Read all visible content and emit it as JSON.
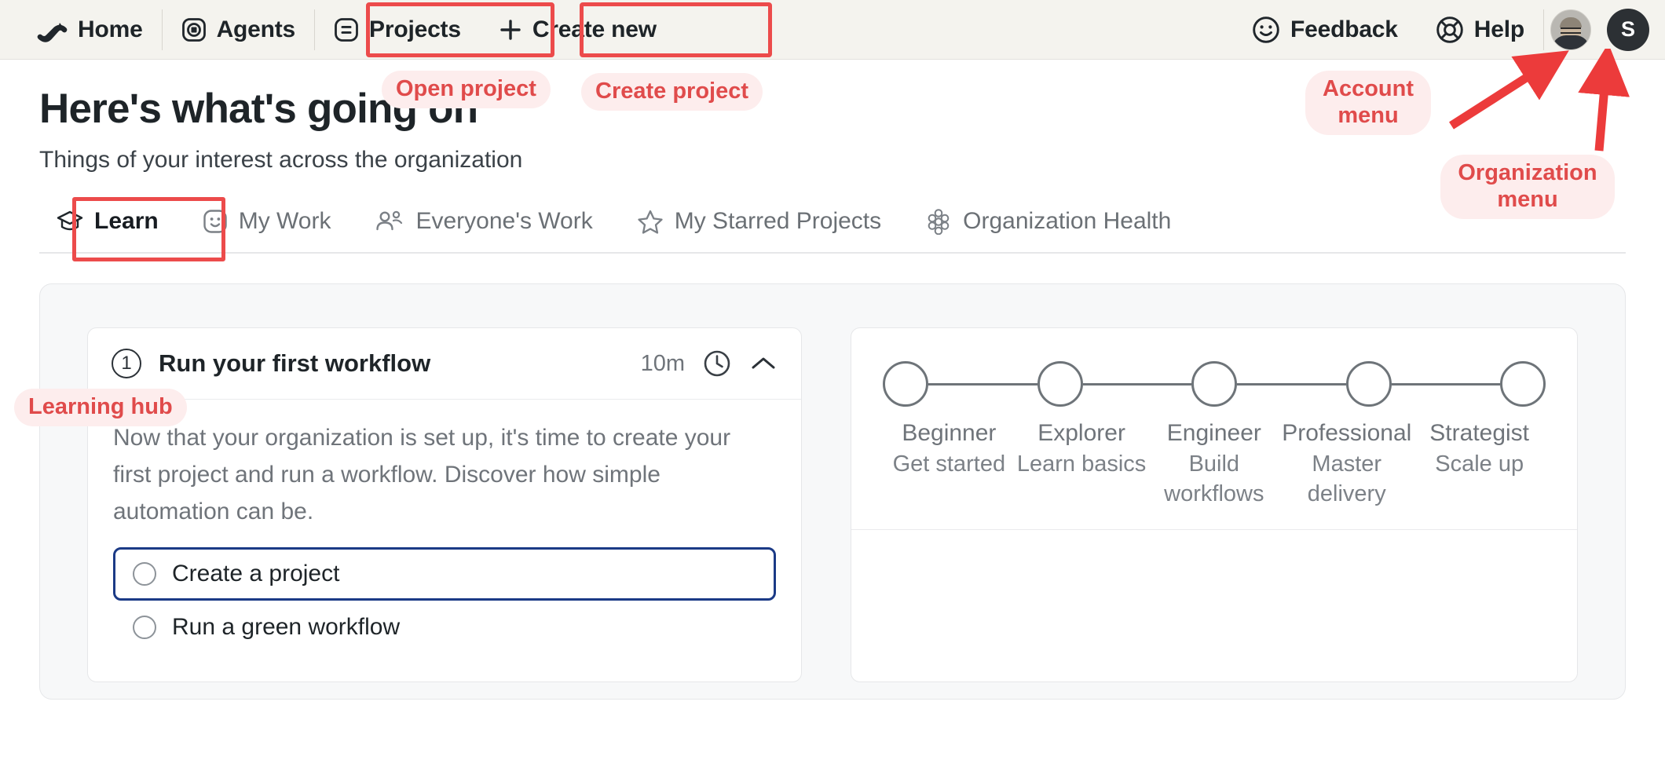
{
  "topnav": {
    "items": [
      {
        "label": "Home",
        "icon": "home-wave-logo-icon"
      },
      {
        "label": "Agents",
        "icon": "agents-square-icon"
      },
      {
        "label": "Projects",
        "icon": "projects-list-icon"
      },
      {
        "label": "Create new",
        "icon": "plus-icon"
      }
    ],
    "right_items": [
      {
        "label": "Feedback",
        "icon": "smiley-face-icon"
      },
      {
        "label": "Help",
        "icon": "lifebuoy-icon"
      }
    ],
    "org_avatar_initial": "S"
  },
  "annotations": {
    "open_project": "Open project",
    "create_project": "Create project",
    "account_menu": "Account menu",
    "organization_menu": "Organization menu",
    "learning_hub": "Learning hub",
    "color": "#E04B4B",
    "background": "#FDEDED"
  },
  "header": {
    "title": "Here's what's going on",
    "subtitle": "Things of your interest across the organization"
  },
  "tabs": [
    {
      "label": "Learn",
      "icon": "graduation-cap-icon",
      "active": true
    },
    {
      "label": "My Work",
      "icon": "smiley-square-icon",
      "active": false
    },
    {
      "label": "Everyone's Work",
      "icon": "people-icon",
      "active": false
    },
    {
      "label": "My Starred Projects",
      "icon": "star-icon",
      "active": false
    },
    {
      "label": "Organization Health",
      "icon": "flower-cluster-icon",
      "active": false
    }
  ],
  "learn_card": {
    "step_number": "1",
    "title": "Run your first workflow",
    "duration": "10m",
    "clock_icon": "clock-icon",
    "collapse_icon": "chevron-up-icon",
    "description": "Now that your organization is set up, it's time to create your first project and run a workflow. Discover how simple automation can be.",
    "tasks": [
      {
        "label": "Create a project",
        "focused": true
      },
      {
        "label": "Run a green workflow",
        "focused": false
      }
    ]
  },
  "progression": {
    "steps": [
      {
        "name": "Beginner",
        "sub": "Get started"
      },
      {
        "name": "Explorer",
        "sub": "Learn basics"
      },
      {
        "name": "Engineer",
        "sub": "Build workflows"
      },
      {
        "name": "Professional",
        "sub": "Master delivery"
      },
      {
        "name": "Strategist",
        "sub": "Scale up"
      }
    ]
  }
}
